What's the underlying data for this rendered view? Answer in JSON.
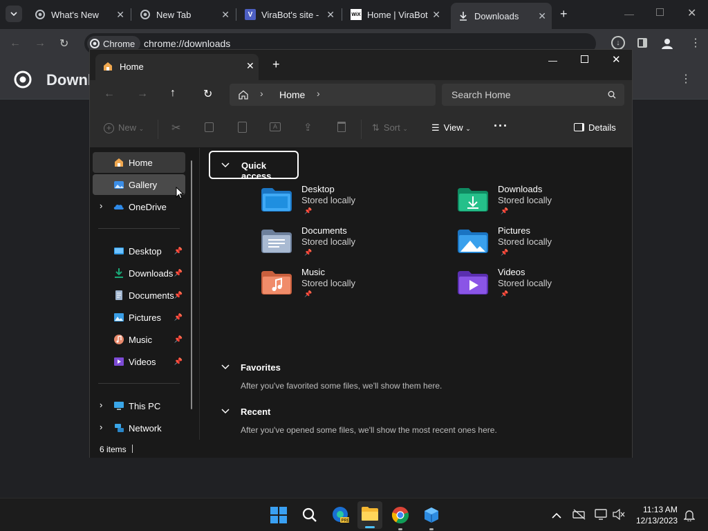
{
  "chrome": {
    "tabs": [
      {
        "title": "What's New",
        "icon": "chrome-icon"
      },
      {
        "title": "New Tab",
        "icon": "chrome-icon"
      },
      {
        "title": "ViraBot's site - ",
        "icon": "virabot-icon"
      },
      {
        "title": "Home | ViraBot",
        "icon": "wix-icon"
      },
      {
        "title": "Downloads",
        "icon": "download-icon"
      }
    ],
    "omnibox_badge": "Chrome",
    "url": "chrome://downloads",
    "page_title": "Downlo"
  },
  "explorer": {
    "tab_title": "Home",
    "breadcrumb": [
      "Home"
    ],
    "search_placeholder": "Search Home",
    "commands": {
      "new": "New",
      "sort": "Sort",
      "view": "View",
      "details": "Details"
    },
    "nav": {
      "top": [
        {
          "label": "Home",
          "icon": "home-icon"
        },
        {
          "label": "Gallery",
          "icon": "gallery-icon"
        },
        {
          "label": "OneDrive",
          "icon": "onedrive-icon"
        }
      ],
      "pinned": [
        {
          "label": "Desktop",
          "icon": "desktop-folder-icon"
        },
        {
          "label": "Downloads",
          "icon": "downloads-folder-icon"
        },
        {
          "label": "Documents",
          "icon": "documents-folder-icon"
        },
        {
          "label": "Pictures",
          "icon": "pictures-folder-icon"
        },
        {
          "label": "Music",
          "icon": "music-folder-icon"
        },
        {
          "label": "Videos",
          "icon": "videos-folder-icon"
        }
      ],
      "bottom": [
        {
          "label": "This PC",
          "icon": "this-pc-icon"
        },
        {
          "label": "Network",
          "icon": "network-icon"
        }
      ]
    },
    "quick_access": {
      "title": "Quick access",
      "items": [
        {
          "name": "Desktop",
          "sub": "Stored locally",
          "color": "#2f9be8"
        },
        {
          "name": "Downloads",
          "sub": "Stored locally",
          "color": "#1aa877"
        },
        {
          "name": "Documents",
          "sub": "Stored locally",
          "color": "#8ea3bf"
        },
        {
          "name": "Pictures",
          "sub": "Stored locally",
          "color": "#3a9ee6"
        },
        {
          "name": "Music",
          "sub": "Stored locally",
          "color": "#e8896b"
        },
        {
          "name": "Videos",
          "sub": "Stored locally",
          "color": "#7d4bd6"
        }
      ]
    },
    "favorites": {
      "title": "Favorites",
      "text": "After you've favorited some files, we'll show them here."
    },
    "recent": {
      "title": "Recent",
      "text": "After you've opened some files, we'll show the most recent ones here."
    },
    "status": "6 items"
  },
  "taskbar": {
    "time": "11:13 AM",
    "date": "12/13/2023"
  }
}
